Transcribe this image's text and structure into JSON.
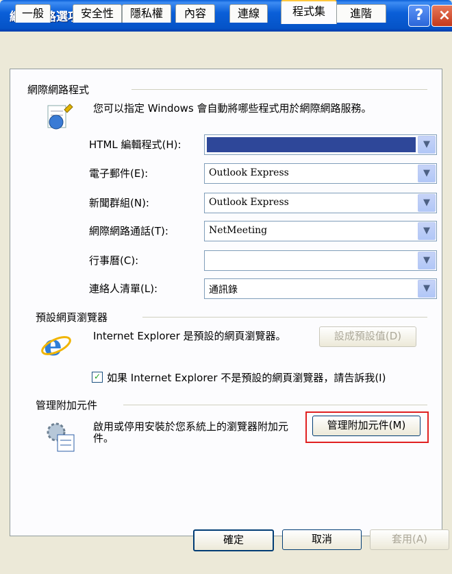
{
  "window": {
    "title": "網際網路選項"
  },
  "tabs": [
    "一般",
    "安全性",
    "隱私權",
    "內容",
    "連線",
    "程式集",
    "進階"
  ],
  "internet_programs": {
    "group_title": "網際網路程式",
    "description": "您可以指定 Windows 會自動將哪些程式用於網際網路服務。",
    "rows": [
      {
        "label": "HTML 編輯程式(H):",
        "value": "",
        "selected": true
      },
      {
        "label": "電子郵件(E):",
        "value": "Outlook Express"
      },
      {
        "label": "新聞群組(N):",
        "value": "Outlook Express"
      },
      {
        "label": "網際網路通話(T):",
        "value": "NetMeeting"
      },
      {
        "label": "行事曆(C):",
        "value": ""
      },
      {
        "label": "連絡人清單(L):",
        "value": "通訊錄"
      }
    ]
  },
  "default_browser": {
    "group_title": "預設網頁瀏覽器",
    "description": "Internet Explorer 是預設的網頁瀏覽器。",
    "set_default_button": "設成預設值(D)",
    "check_label": "如果 Internet Explorer 不是預設的網頁瀏覽器，請告訴我(I)",
    "checked": true
  },
  "addons": {
    "group_title": "管理附加元件",
    "description": "啟用或停用安裝於您系統上的瀏覽器附加元件。",
    "manage_button": "管理附加元件(M)"
  },
  "footer": {
    "ok": "確定",
    "cancel": "取消",
    "apply": "套用(A)"
  },
  "colors": {
    "title_bar": "#0a5fd8",
    "selection": "#2e4799",
    "highlight": "#e02020"
  }
}
